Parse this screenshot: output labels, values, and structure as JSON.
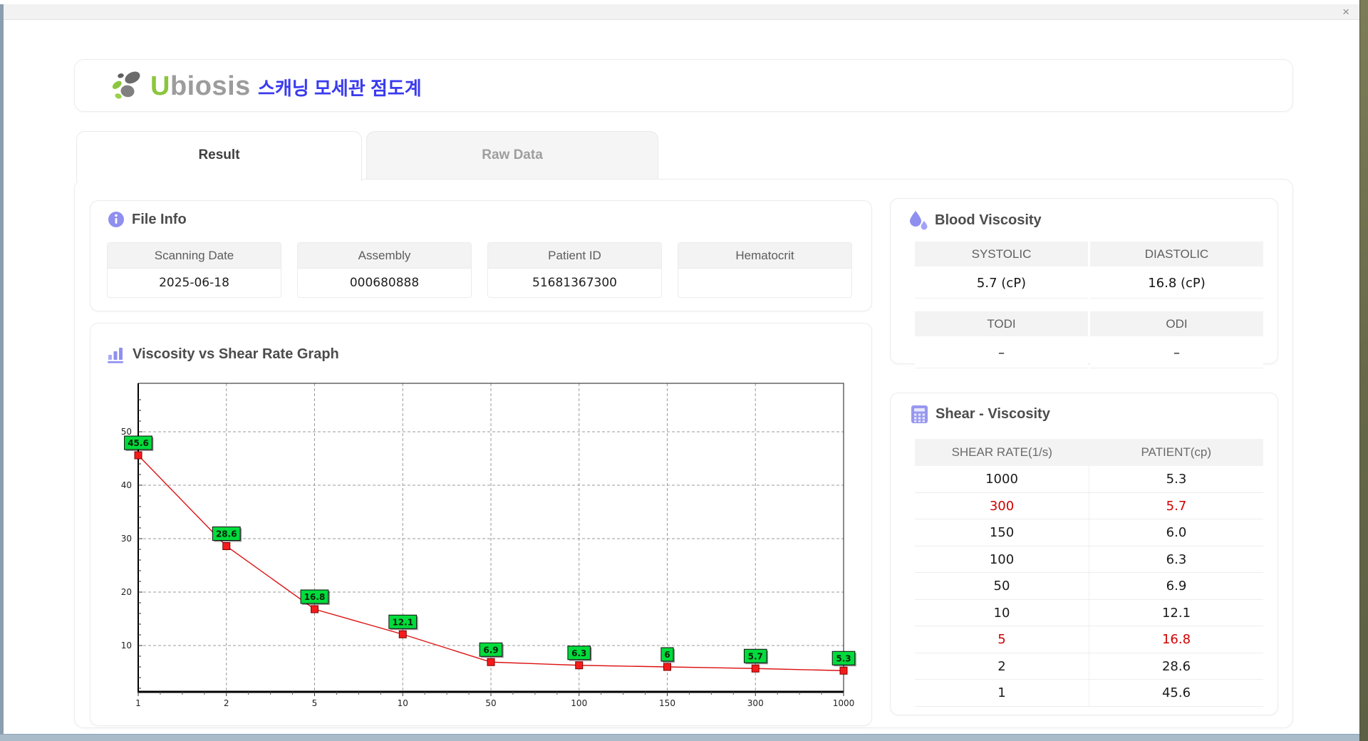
{
  "window": {
    "close_label": "×"
  },
  "header": {
    "logo_u": "U",
    "logo_rest": "biosis",
    "app_title_korean": "스캐닝 모세관 점도계"
  },
  "tabs": [
    {
      "label": "Result",
      "active": true
    },
    {
      "label": "Raw Data",
      "active": false
    }
  ],
  "file_info": {
    "title": "File Info",
    "fields": [
      {
        "label": "Scanning Date",
        "value": "2025-06-18"
      },
      {
        "label": "Assembly",
        "value": "000680888"
      },
      {
        "label": "Patient ID",
        "value": "51681367300"
      },
      {
        "label": "Hematocrit",
        "value": ""
      }
    ]
  },
  "blood_viscosity": {
    "title": "Blood Viscosity",
    "cells": [
      {
        "label": "SYSTOLIC",
        "value": "5.7 (cP)"
      },
      {
        "label": "DIASTOLIC",
        "value": "16.8 (cP)"
      },
      {
        "label": "TODI",
        "value": "–"
      },
      {
        "label": "ODI",
        "value": "–"
      }
    ]
  },
  "graph": {
    "title": "Viscosity vs Shear Rate Graph"
  },
  "chart_data": {
    "type": "line",
    "title": "Viscosity vs Shear Rate Graph",
    "x": [
      1,
      2,
      5,
      10,
      50,
      100,
      150,
      300,
      1000
    ],
    "y": [
      45.6,
      28.6,
      16.8,
      12.1,
      6.9,
      6.3,
      6.0,
      5.7,
      5.3
    ],
    "point_labels": [
      "45.6",
      "28.6",
      "16.8",
      "12.1",
      "6.9",
      "6.3",
      "6",
      "5.7",
      "5.3"
    ],
    "x_tick_labels": [
      "1",
      "2",
      "5",
      "10",
      "50",
      "100",
      "150",
      "300",
      "1000"
    ],
    "y_ticks": [
      10,
      20,
      30,
      40,
      50
    ],
    "ylim": [
      1.3,
      57.7
    ],
    "x_scale": "equal-spaced-categories",
    "grid": "dashed",
    "line_color": "#dd1111",
    "marker_color": "#f51b1b",
    "marker_border": "#7e0000",
    "label_bg": "#00dc3c",
    "label_border": "#0a0a0a"
  },
  "shear_table": {
    "title": "Shear - Viscosity",
    "columns": [
      "SHEAR RATE(1/s)",
      "PATIENT(cp)"
    ],
    "rows": [
      {
        "shear_rate": "1000",
        "patient": "5.3",
        "highlight": false
      },
      {
        "shear_rate": "300",
        "patient": "5.7",
        "highlight": true
      },
      {
        "shear_rate": "150",
        "patient": "6.0",
        "highlight": false
      },
      {
        "shear_rate": "100",
        "patient": "6.3",
        "highlight": false
      },
      {
        "shear_rate": "50",
        "patient": "6.9",
        "highlight": false
      },
      {
        "shear_rate": "10",
        "patient": "12.1",
        "highlight": false
      },
      {
        "shear_rate": "5",
        "patient": "16.8",
        "highlight": true
      },
      {
        "shear_rate": "2",
        "patient": "28.6",
        "highlight": false
      },
      {
        "shear_rate": "1",
        "patient": "45.6",
        "highlight": false
      }
    ]
  },
  "colors": {
    "accent_periwinkle": "#8f8ff0",
    "brand_green": "#8cc63e",
    "brand_gray": "#9c9c9c",
    "title_blue": "#3a3af0",
    "highlight_red": "#d10000",
    "chart_line_red": "#dd1111",
    "chart_label_green": "#00dc3c"
  }
}
